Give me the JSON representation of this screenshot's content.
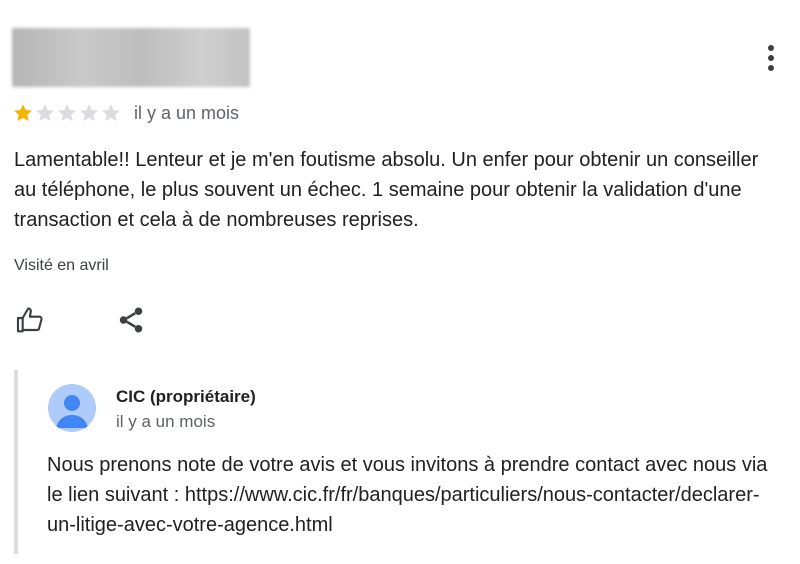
{
  "review": {
    "rating": 1,
    "max_rating": 5,
    "time": "il y a un mois",
    "text": "Lamentable!! Lenteur et je m'en foutisme absolu. Un enfer pour obtenir un conseiller au téléphone, le plus souvent un échec. 1 semaine pour obtenir la validation d'une transaction et cela à de nombreuses reprises.",
    "visited": "Visité en avril"
  },
  "icons": {
    "more": "more-vert-icon",
    "like": "thumbs-up-icon",
    "share": "share-icon",
    "star_filled": "star-filled-icon",
    "star_empty": "star-empty-icon",
    "avatar": "person-icon"
  },
  "colors": {
    "star_filled": "#F4B400",
    "star_empty": "#DADCE0",
    "avatar_bg": "#AECBFA",
    "avatar_fg": "#4285F4"
  },
  "owner_reply": {
    "name": "CIC (propriétaire)",
    "time": "il y a un mois",
    "text": "Nous prenons note de votre avis et vous invitons à prendre contact avec nous via le lien suivant : https://www.cic.fr/fr/banques/particuliers/nous-contacter/declarer-un-litige-avec-votre-agence.html"
  }
}
